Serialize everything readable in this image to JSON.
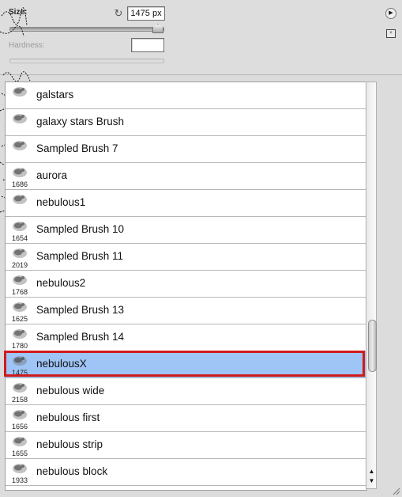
{
  "controls": {
    "size_label": "Size:",
    "size_value": "1475 px",
    "hardness_label": "Hardness:",
    "hardness_value": ""
  },
  "brushes": [
    {
      "num": "",
      "name": "galstars"
    },
    {
      "num": "",
      "name": "galaxy stars Brush"
    },
    {
      "num": "",
      "name": "Sampled Brush 7"
    },
    {
      "num": "1686",
      "name": "aurora"
    },
    {
      "num": "",
      "name": "nebulous1"
    },
    {
      "num": "1654",
      "name": "Sampled Brush 10"
    },
    {
      "num": "2019",
      "name": "Sampled Brush 11"
    },
    {
      "num": "1768",
      "name": "nebulous2"
    },
    {
      "num": "1625",
      "name": "Sampled Brush 13"
    },
    {
      "num": "1780",
      "name": "Sampled Brush 14"
    },
    {
      "num": "1475",
      "name": "nebulousX",
      "selected": true
    },
    {
      "num": "2158",
      "name": "nebulous wide"
    },
    {
      "num": "1656",
      "name": "nebulous first"
    },
    {
      "num": "1655",
      "name": "nebulous strip"
    },
    {
      "num": "1933",
      "name": "nebulous block"
    }
  ],
  "colors": {
    "selection": "#9fc4f6",
    "highlight_border": "#d11a1a"
  },
  "icons": {
    "reset": "reset-icon",
    "panel_menu": "panel-menu-icon",
    "new_preset": "new-preset-icon",
    "scroll_up": "arrow-up-icon",
    "scroll_down": "arrow-down-icon",
    "resize": "resize-grip-icon"
  }
}
